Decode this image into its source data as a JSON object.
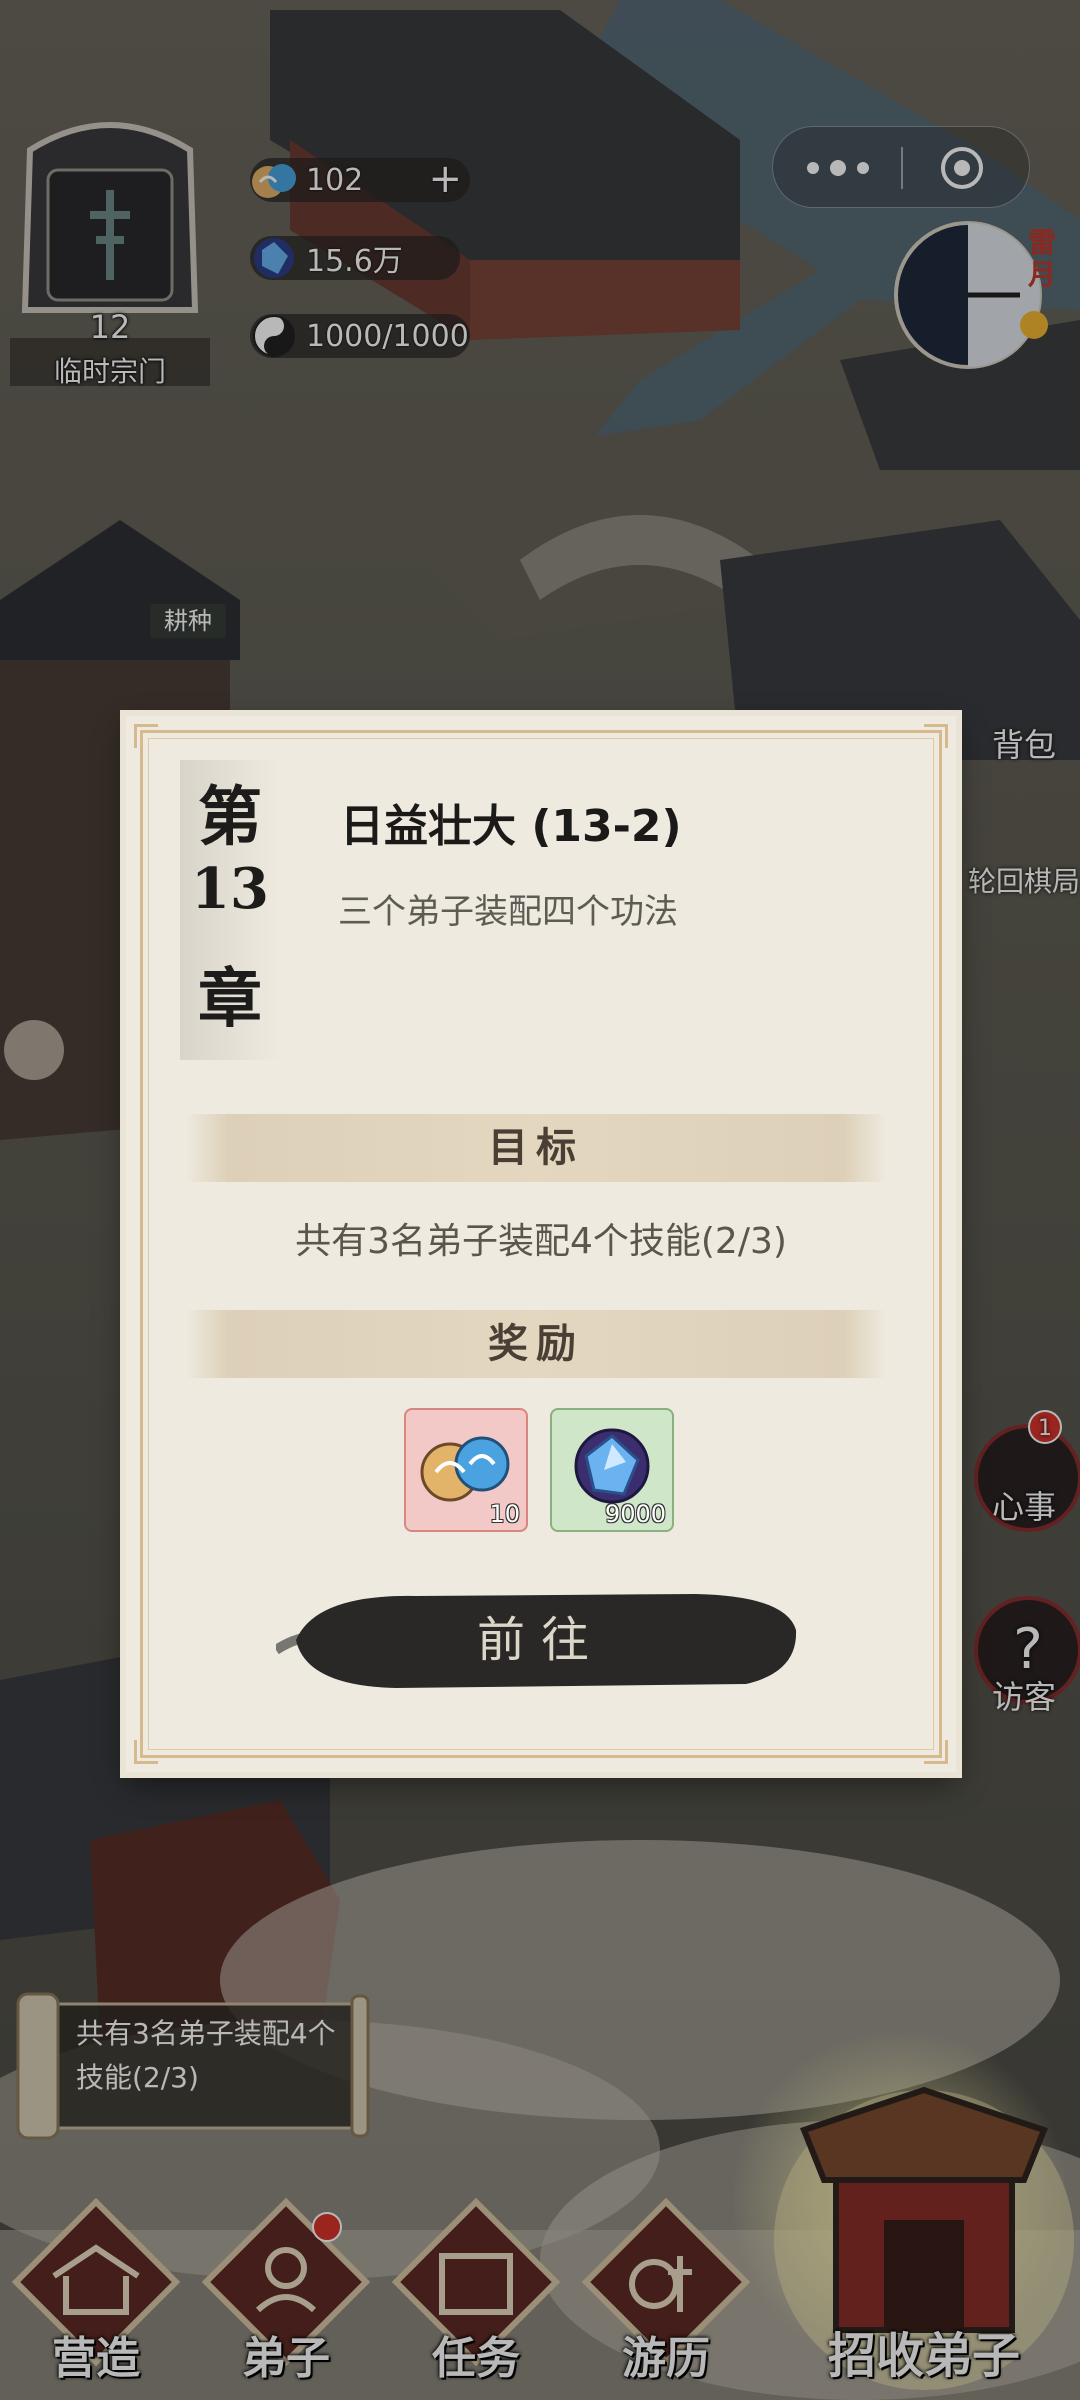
{
  "sect": {
    "level": "12",
    "name": "临时宗门"
  },
  "resources": [
    {
      "icon": "cloud-swirl-icon",
      "value": "102",
      "has_plus": true
    },
    {
      "icon": "spirit-stone-icon",
      "value": "15.6万"
    },
    {
      "icon": "yin-yang-icon",
      "value": "1000/1000"
    }
  ],
  "clock": {
    "label": "雷月"
  },
  "scene_labels": {
    "farming": "耕种"
  },
  "side_buttons": [
    {
      "label": "背包",
      "icon": "bag-icon"
    },
    {
      "label": "轮回棋局",
      "icon": "chessboard-icon"
    },
    {
      "label": "心事",
      "icon": "heart-matter-icon",
      "badge": "1"
    },
    {
      "label": "访客",
      "icon": "question-visitor-icon"
    }
  ],
  "quest_modal": {
    "chapter_chars": [
      "第",
      "13",
      "章"
    ],
    "title": "日益壮大 (13-2)",
    "description": "三个弟子装配四个功法",
    "goal_heading": "目标",
    "goal_text": "共有3名弟子装配4个技能(2/3)",
    "reward_heading": "奖励",
    "rewards": [
      {
        "icon": "cloud-swirl-icon",
        "qty": "10",
        "color": "#f2c9c6"
      },
      {
        "icon": "spirit-stone-icon",
        "qty": "9000",
        "color": "#cfe6c8"
      }
    ],
    "go_label": "前往"
  },
  "tracker": {
    "text": "共有3名弟子装配4个技能(2/3)"
  },
  "nav": [
    {
      "label": "营造",
      "icon": "pavilion-icon"
    },
    {
      "label": "弟子",
      "icon": "disciple-icon",
      "badge": true
    },
    {
      "label": "任务",
      "icon": "scroll-task-icon"
    },
    {
      "label": "游历",
      "icon": "travel-icon"
    }
  ],
  "recruit": {
    "label": "招收弟子",
    "icon": "gate-icon"
  }
}
